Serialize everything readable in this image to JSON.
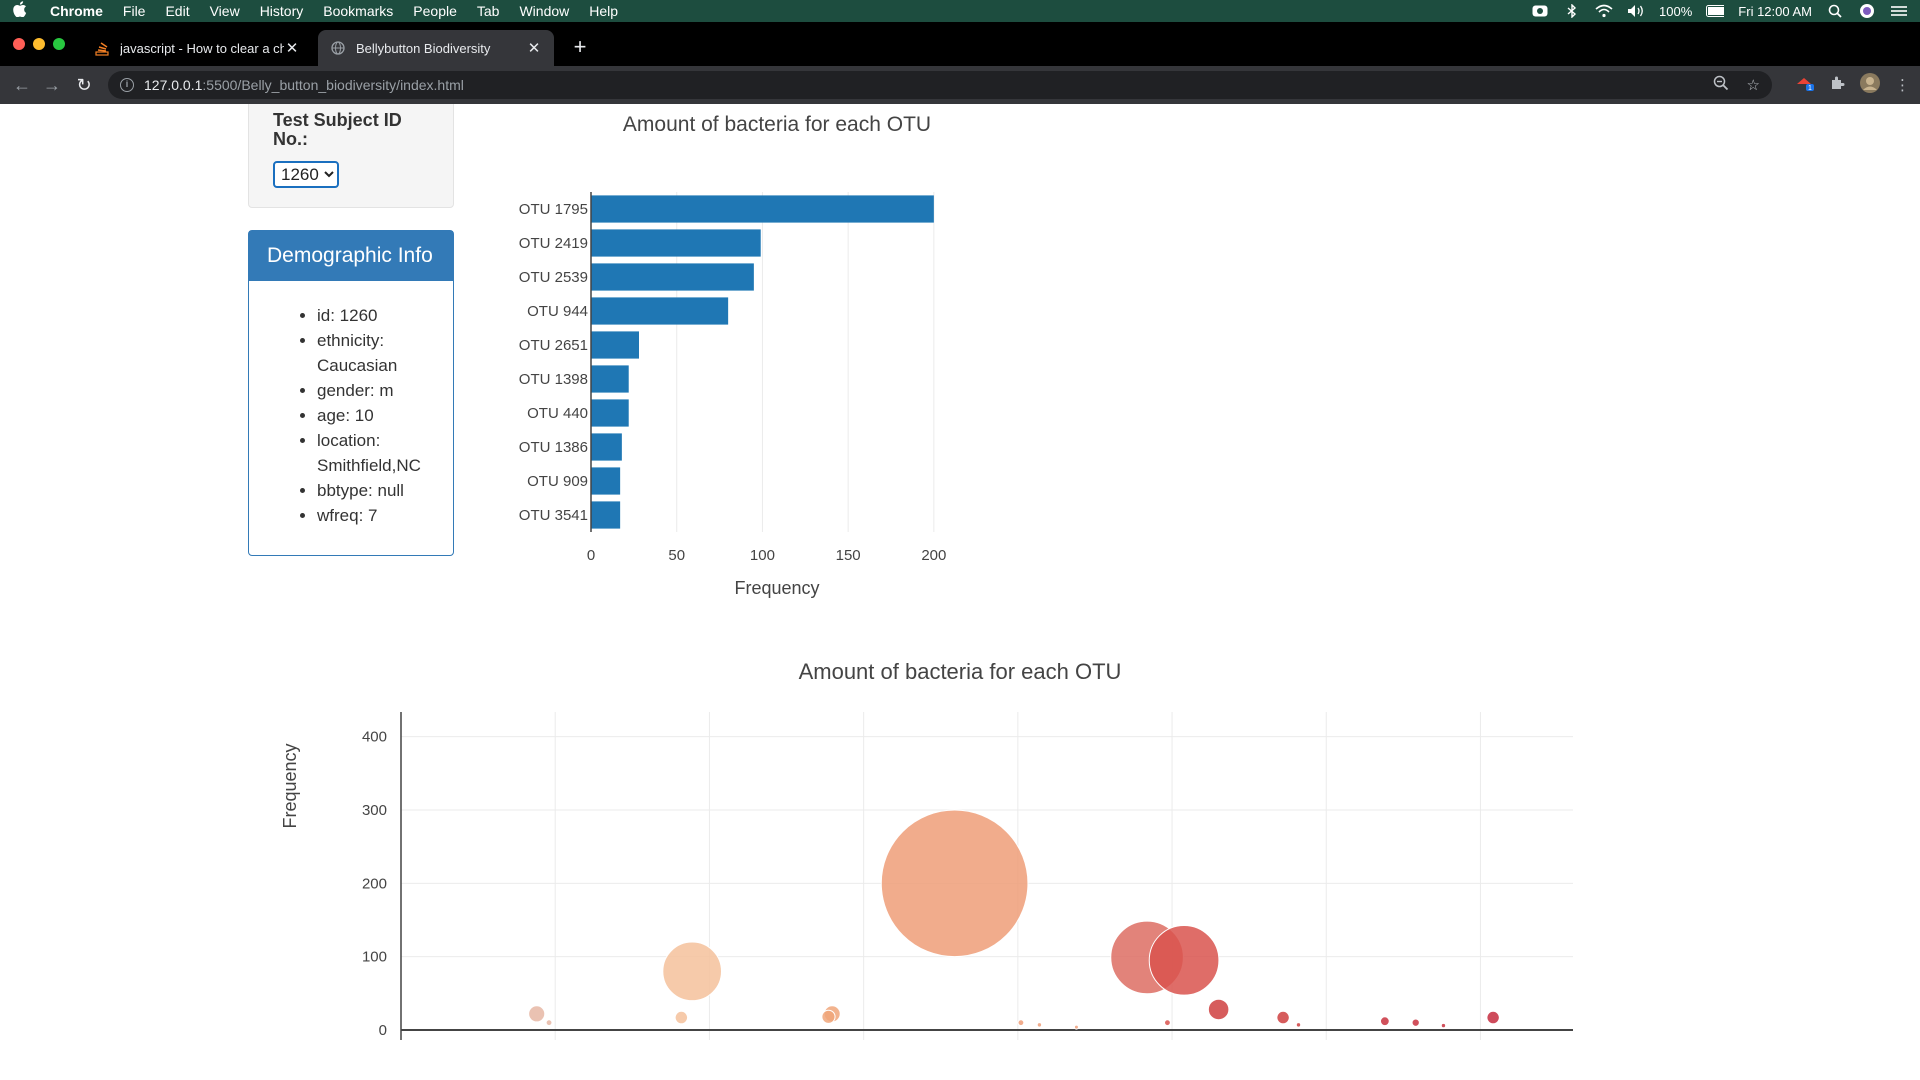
{
  "menubar": {
    "app": "Chrome",
    "items": [
      "File",
      "Edit",
      "View",
      "History",
      "Bookmarks",
      "People",
      "Tab",
      "Window",
      "Help"
    ],
    "battery": "100%",
    "clock": "Fri 12:00 AM"
  },
  "tabs": [
    {
      "title": "javascript - How to clear a cha",
      "favicon": "stackoverflow-icon",
      "active": false
    },
    {
      "title": "Bellybutton Biodiversity",
      "favicon": "globe-icon",
      "active": true
    }
  ],
  "address": {
    "host": "127.0.0.1",
    "path": ":5500/Belly_button_biodiversity/index.html"
  },
  "selector": {
    "label": "Test Subject ID No.:",
    "value": "1260"
  },
  "demographic": {
    "title": "Demographic Info",
    "items": [
      "id: 1260",
      "ethnicity: Caucasian",
      "gender: m",
      "age: 10",
      "location: Smithfield,NC",
      "bbtype: null",
      "wfreq: 7"
    ]
  },
  "chart_data": [
    {
      "type": "bar",
      "orientation": "horizontal",
      "title": "Amount of bacteria for each OTU",
      "xlabel": "Frequency",
      "ylabel": "",
      "categories": [
        "OTU 1795",
        "OTU 2419",
        "OTU 2539",
        "OTU 944",
        "OTU 2651",
        "OTU 1398",
        "OTU 440",
        "OTU 1386",
        "OTU 909",
        "OTU 3541"
      ],
      "values": [
        200,
        99,
        95,
        80,
        28,
        22,
        22,
        18,
        17,
        17
      ],
      "xlim": [
        0,
        210
      ],
      "xticks": [
        0,
        50,
        100,
        150,
        200
      ],
      "color": "#1f77b4",
      "grid": true
    },
    {
      "type": "scatter",
      "mode": "bubble",
      "title": "Amount of bacteria for each OTU",
      "ylabel": "Frequency",
      "xlabel": "",
      "ylim": [
        0,
        420
      ],
      "yticks": [
        0,
        100,
        200,
        300,
        400
      ],
      "xlim": [
        0,
        3800
      ],
      "grid": true,
      "points": [
        {
          "x": 440,
          "y": 22,
          "size": 22,
          "color": "#e6b7a4"
        },
        {
          "x": 480,
          "y": 10,
          "size": 8,
          "color": "#e6b7a4"
        },
        {
          "x": 944,
          "y": 80,
          "size": 80,
          "color": "#f4c19b"
        },
        {
          "x": 909,
          "y": 17,
          "size": 17,
          "color": "#f4c19b"
        },
        {
          "x": 1386,
          "y": 18,
          "size": 18,
          "color": "#f0a67a"
        },
        {
          "x": 1398,
          "y": 22,
          "size": 22,
          "color": "#f0a67a"
        },
        {
          "x": 1795,
          "y": 200,
          "size": 200,
          "color": "#ee9e78"
        },
        {
          "x": 2419,
          "y": 99,
          "size": 99,
          "color": "#dd6d63"
        },
        {
          "x": 2539,
          "y": 95,
          "size": 95,
          "color": "#d9544d"
        },
        {
          "x": 2485,
          "y": 10,
          "size": 8,
          "color": "#d9544d"
        },
        {
          "x": 2651,
          "y": 28,
          "size": 28,
          "color": "#cf3f3f"
        },
        {
          "x": 2860,
          "y": 17,
          "size": 17,
          "color": "#cf3f3f"
        },
        {
          "x": 2910,
          "y": 7,
          "size": 6,
          "color": "#cf3f3f"
        },
        {
          "x": 3190,
          "y": 12,
          "size": 12,
          "color": "#c9323f"
        },
        {
          "x": 3290,
          "y": 10,
          "size": 10,
          "color": "#c9323f"
        },
        {
          "x": 3380,
          "y": 6,
          "size": 6,
          "color": "#c9323f"
        },
        {
          "x": 3541,
          "y": 17,
          "size": 17,
          "color": "#c62c3e"
        },
        {
          "x": 2010,
          "y": 10,
          "size": 8,
          "color": "#ee9e78"
        },
        {
          "x": 2070,
          "y": 7,
          "size": 6,
          "color": "#ee9e78"
        },
        {
          "x": 2190,
          "y": 4,
          "size": 4,
          "color": "#ee9e78"
        }
      ]
    }
  ]
}
